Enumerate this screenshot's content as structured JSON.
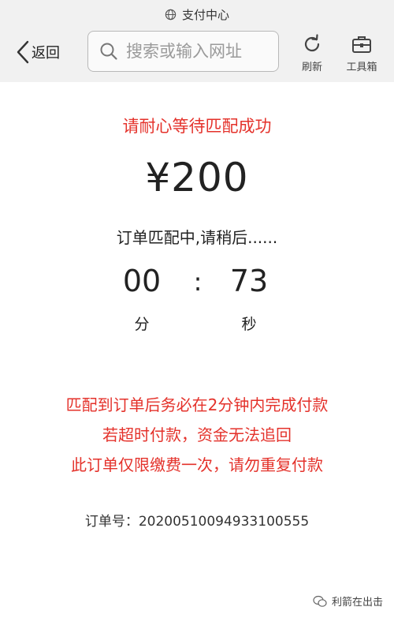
{
  "browser": {
    "site_title": "支付中心",
    "back_label": "返回",
    "search_placeholder": "搜索或输入网址",
    "refresh_label": "刷新",
    "toolbox_label": "工具箱"
  },
  "payment": {
    "notice": "请耐心等待匹配成功",
    "amount": "¥200",
    "status": "订单匹配中,请稍后......",
    "timer": {
      "minutes": "00",
      "separator": ":",
      "seconds": "73",
      "minutes_unit": "分",
      "seconds_unit": "秒"
    },
    "warnings": [
      "匹配到订单后务必在2分钟内完成付款",
      "若超时付款，资金无法追回",
      "此订单仅限缴费一次，请勿重复付款"
    ],
    "order_label": "订单号：",
    "order_number": "20200510094933100555"
  },
  "watermark": {
    "text": "利箭在出击"
  },
  "colors": {
    "warning_red": "#e4322b",
    "browser_bar_bg": "#f1f1f1"
  }
}
